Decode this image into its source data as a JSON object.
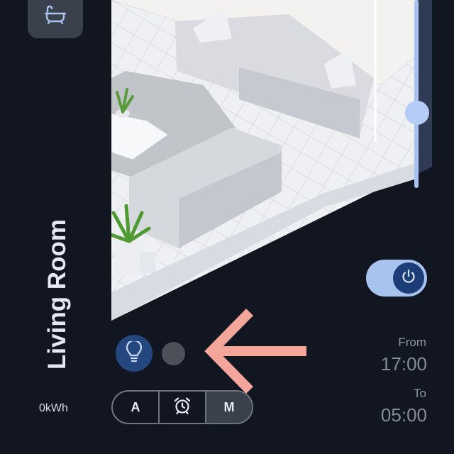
{
  "sidebar": {
    "top_icon": "bathtub-icon"
  },
  "room": {
    "title": "Living Room",
    "image": "isometric living room illustration"
  },
  "controls": {
    "brightness": {
      "level": 0.4,
      "icon": "slider-thumb"
    },
    "power": {
      "state": "on",
      "icon": "power-icon"
    },
    "light": {
      "icon": "lightbulb-icon",
      "accent": "#24477f"
    },
    "status_dot_color": "#4c5058"
  },
  "schedule": {
    "from_label": "From",
    "from_time": "17:00",
    "to_label": "To",
    "to_time": "05:00"
  },
  "energy": {
    "usage": "0kWh"
  },
  "mode": {
    "options": [
      {
        "label": "A",
        "icon": null
      },
      {
        "label": "",
        "icon": "alarm-clock-icon"
      },
      {
        "label": "M",
        "icon": null
      }
    ],
    "selected_index": 2
  },
  "annotation": {
    "icon": "arrow-left-icon",
    "color": "#f4a69b"
  },
  "colors": {
    "background": "#111620",
    "accent_light": "#a9c3ef",
    "accent_dark": "#1d3d78"
  }
}
